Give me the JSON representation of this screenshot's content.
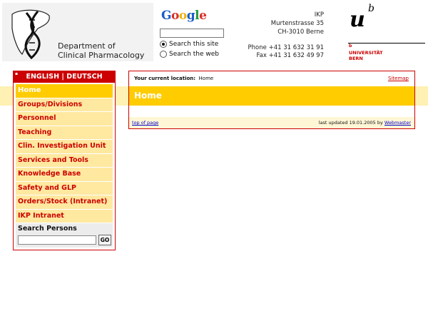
{
  "header": {
    "dept_line1": "Department of",
    "dept_line2": "Clinical Pharmacology",
    "google": {
      "letters": [
        "G",
        "o",
        "o",
        "g",
        "l",
        "e"
      ],
      "option_site": "Search this site",
      "option_web": "Search the web",
      "search_value": ""
    },
    "address": [
      "IKP",
      "Murtenstrasse 35",
      "CH-3010 Berne"
    ],
    "phone": "Phone +41 31 632 31 91",
    "fax": "Fax +41 31 632 49 97",
    "uni": {
      "mark_u": "u",
      "mark_b": "b",
      "small_b": "b",
      "line1": "UNIVERSITÄT",
      "line2": "BERN"
    }
  },
  "colors": {
    "accent_red": "#cc0000",
    "accent_yellow": "#ffcc00",
    "nav_bg": "#ffe8a0",
    "google": [
      "#1a5cc8",
      "#d93025",
      "#f2b20a",
      "#1a5cc8",
      "#1e9a3c",
      "#d93025"
    ]
  },
  "sidebar": {
    "lang_english": "ENGLISH",
    "lang_sep": "|",
    "lang_deutsch": "DEUTSCH",
    "items": [
      {
        "label": "Home",
        "active": true
      },
      {
        "label": "Groups/Divisions",
        "active": false
      },
      {
        "label": "Personnel",
        "active": false
      },
      {
        "label": "Teaching",
        "active": false
      },
      {
        "label": "Clin. Investigation Unit",
        "active": false
      },
      {
        "label": "Services and Tools",
        "active": false
      },
      {
        "label": "Knowledge Base",
        "active": false
      },
      {
        "label": "Safety and GLP",
        "active": false
      },
      {
        "label": "Orders/Stock (Intranet)",
        "active": false
      },
      {
        "label": "IKP Intranet",
        "active": false
      }
    ],
    "search_persons_label": "Search Persons",
    "search_persons_value": "",
    "go_label": "GO"
  },
  "main": {
    "location_label": "Your current location:",
    "location_value": "Home",
    "sitemap": "Sitemap",
    "title": "Home",
    "top_of_page": "top of page",
    "last_updated": "last updated 19.01.2005 by",
    "webmaster": "Webmaster"
  }
}
